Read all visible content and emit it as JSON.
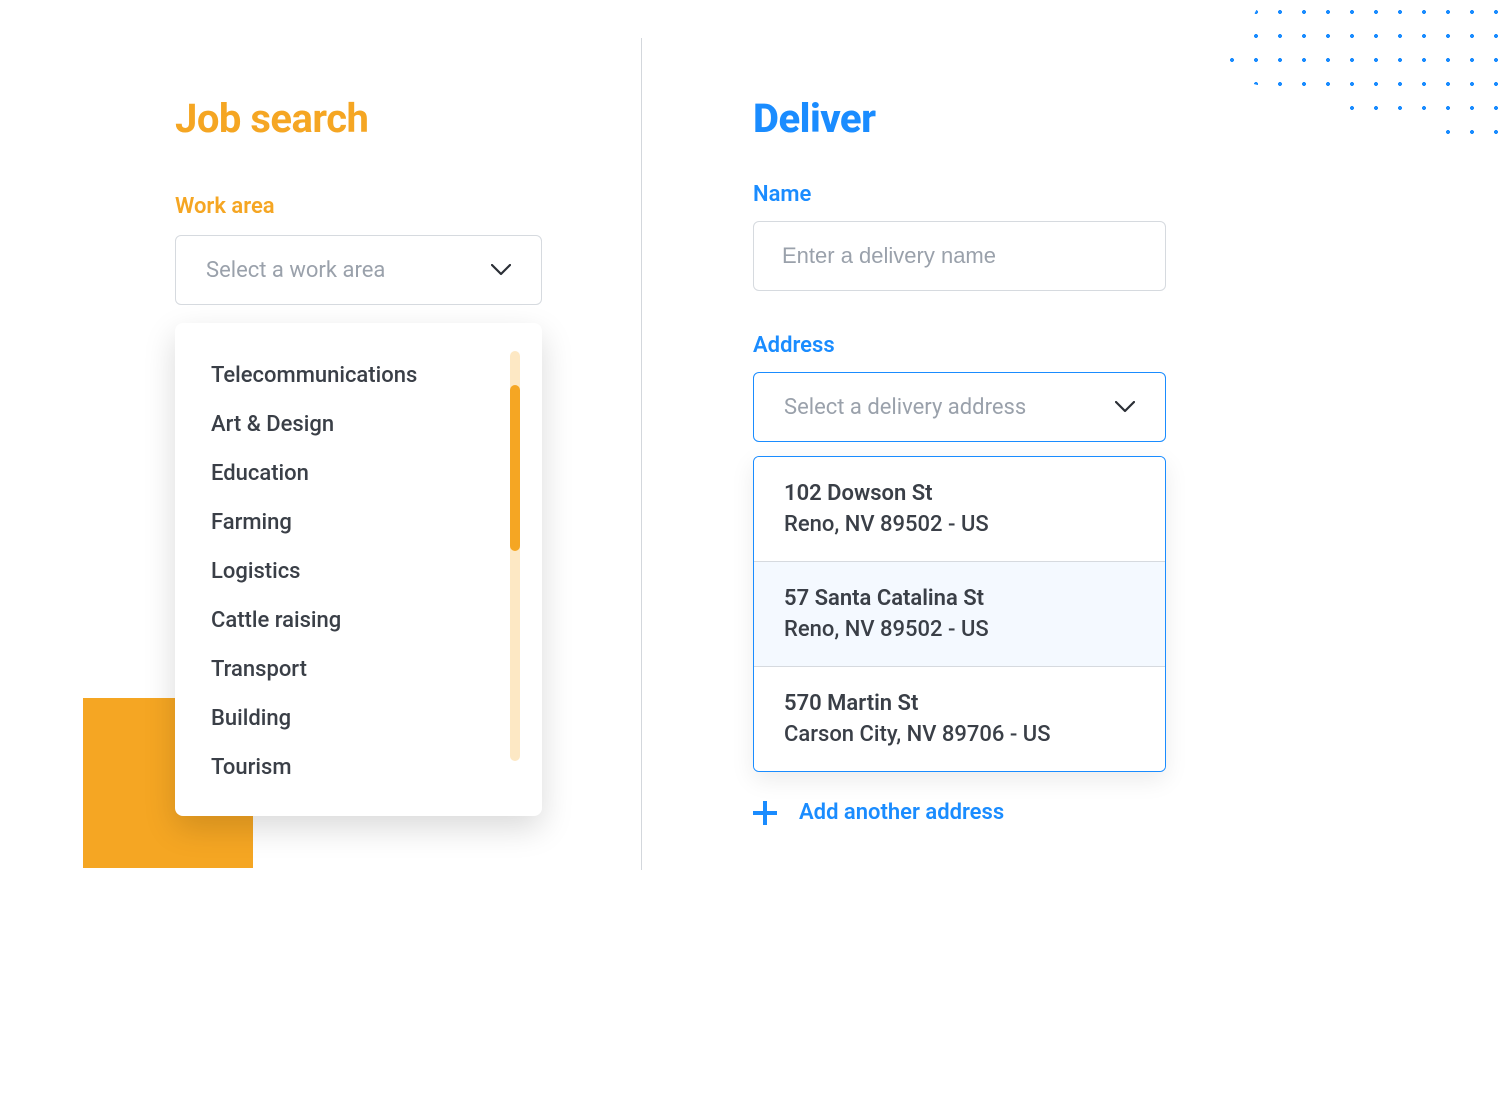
{
  "left": {
    "title": "Job search",
    "work_area_label": "Work area",
    "work_area_placeholder": "Select a work area",
    "options": [
      "Telecommunications",
      "Art & Design",
      "Education",
      "Farming",
      "Logistics",
      "Cattle raising",
      "Transport",
      "Building",
      "Tourism"
    ]
  },
  "right": {
    "title": "Deliver",
    "name_label": "Name",
    "name_placeholder": "Enter a delivery name",
    "address_label": "Address",
    "address_placeholder": "Select a delivery address",
    "addresses": [
      {
        "line1": "102 Dowson St",
        "line2": "Reno, NV 89502 - US",
        "highlight": false
      },
      {
        "line1": "57 Santa Catalina St",
        "line2": "Reno, NV 89502 - US",
        "highlight": true
      },
      {
        "line1": "570 Martin St",
        "line2": "Carson City, NV 89706 - US",
        "highlight": false
      }
    ],
    "add_another": "Add another address"
  },
  "colors": {
    "orange": "#f5a623",
    "blue": "#1a8cff",
    "text": "#3a3f47",
    "muted": "#9aa1ab",
    "border": "#d6dadf"
  }
}
